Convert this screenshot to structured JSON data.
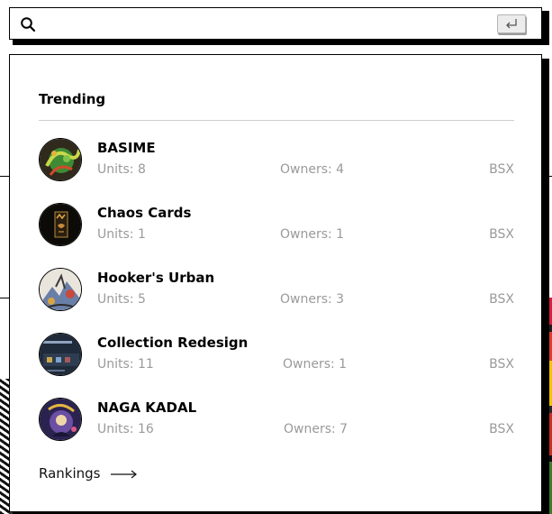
{
  "search": {
    "value": "",
    "placeholder": ""
  },
  "trending": {
    "heading": "Trending",
    "items": [
      {
        "name": "BASIME",
        "units_label": "Units: 8",
        "owners_label": "Owners: 4",
        "chain": "BSX"
      },
      {
        "name": "Chaos Cards",
        "units_label": "Units: 1",
        "owners_label": "Owners: 1",
        "chain": "BSX"
      },
      {
        "name": "Hooker's Urban",
        "units_label": "Units: 5",
        "owners_label": "Owners: 3",
        "chain": "BSX"
      },
      {
        "name": "Collection Redesign",
        "units_label": "Units: 11",
        "owners_label": "Owners: 1",
        "chain": "BSX"
      },
      {
        "name": "NAGA KADAL",
        "units_label": "Units: 16",
        "owners_label": "Owners: 7",
        "chain": "BSX"
      }
    ]
  },
  "rankings_link": {
    "label": "Rankings"
  },
  "colors": {
    "text_primary": "#000000",
    "text_muted": "#9a9a9a",
    "divider": "#cfcfcf"
  },
  "icons": {
    "search": "search-icon",
    "enter": "enter-key-icon",
    "arrow": "arrow-right-icon"
  }
}
